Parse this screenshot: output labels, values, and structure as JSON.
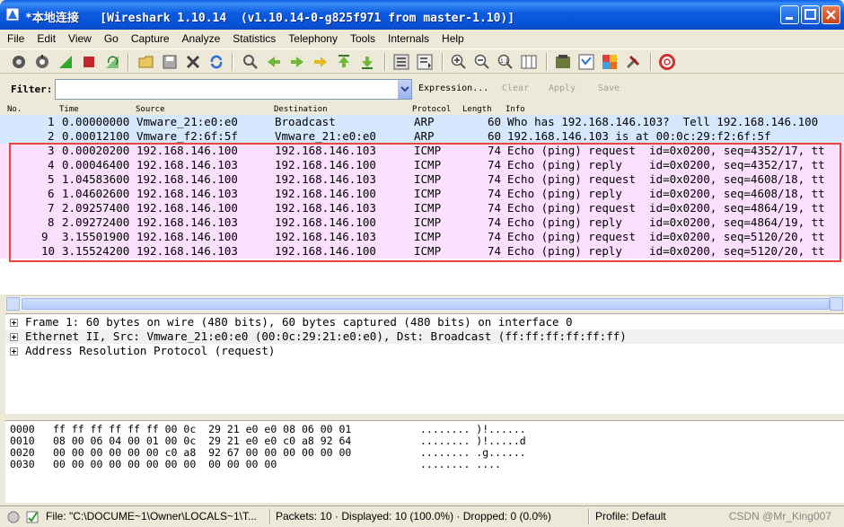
{
  "window": {
    "title": "*本地连接   [Wireshark 1.10.14  (v1.10.14-0-g825f971 from master-1.10)]",
    "accent": "#0A5FE8"
  },
  "menu": [
    "File",
    "Edit",
    "View",
    "Go",
    "Capture",
    "Analyze",
    "Statistics",
    "Telephony",
    "Tools",
    "Internals",
    "Help"
  ],
  "toolbar_icons": [
    "interfaces-icon",
    "options-icon",
    "start-capture-icon",
    "stop-capture-icon",
    "restart-capture-icon",
    "open-file-icon",
    "save-file-icon",
    "close-file-icon",
    "reload-icon",
    "find-packet-icon",
    "go-back-icon",
    "go-forward-icon",
    "go-to-packet-icon",
    "go-first-icon",
    "go-last-icon",
    "colorize-icon",
    "autoscroll-icon",
    "zoom-in-icon",
    "zoom-out-icon",
    "normal-size-icon",
    "resize-columns-icon",
    "capture-filters-icon",
    "display-filters-icon",
    "coloring-rules-icon",
    "preferences-icon",
    "help-icon"
  ],
  "filter": {
    "label": "Filter:",
    "value": "",
    "expression": "Expression...",
    "clear": "Clear",
    "apply": "Apply",
    "save": "Save"
  },
  "columns": [
    "No.",
    "Time",
    "Source",
    "Destination",
    "Protocol",
    "Length",
    "Info"
  ],
  "packets": [
    {
      "no": "1",
      "time": "0.00000000",
      "src": "Vmware_21:e0:e0",
      "dst": "Broadcast",
      "proto": "ARP",
      "len": "60",
      "info": "Who has 192.168.146.103?  Tell 192.168.146.100"
    },
    {
      "no": "2",
      "time": "0.00012100",
      "src": "Vmware_f2:6f:5f",
      "dst": "Vmware_21:e0:e0",
      "proto": "ARP",
      "len": "60",
      "info": "192.168.146.103 is at 00:0c:29:f2:6f:5f"
    },
    {
      "no": "3",
      "time": "0.00020200",
      "src": "192.168.146.100",
      "dst": "192.168.146.103",
      "proto": "ICMP",
      "len": "74",
      "info": "Echo (ping) request  id=0x0200, seq=4352/17, tt"
    },
    {
      "no": "4",
      "time": "0.00046400",
      "src": "192.168.146.103",
      "dst": "192.168.146.100",
      "proto": "ICMP",
      "len": "74",
      "info": "Echo (ping) reply    id=0x0200, seq=4352/17, tt"
    },
    {
      "no": "5",
      "time": "1.04583600",
      "src": "192.168.146.100",
      "dst": "192.168.146.103",
      "proto": "ICMP",
      "len": "74",
      "info": "Echo (ping) request  id=0x0200, seq=4608/18, tt"
    },
    {
      "no": "6",
      "time": "1.04602600",
      "src": "192.168.146.103",
      "dst": "192.168.146.100",
      "proto": "ICMP",
      "len": "74",
      "info": "Echo (ping) reply    id=0x0200, seq=4608/18, tt"
    },
    {
      "no": "7",
      "time": "2.09257400",
      "src": "192.168.146.100",
      "dst": "192.168.146.103",
      "proto": "ICMP",
      "len": "74",
      "info": "Echo (ping) request  id=0x0200, seq=4864/19, tt"
    },
    {
      "no": "8",
      "time": "2.09272400",
      "src": "192.168.146.103",
      "dst": "192.168.146.100",
      "proto": "ICMP",
      "len": "74",
      "info": "Echo (ping) reply    id=0x0200, seq=4864/19, tt"
    },
    {
      "no": "9",
      "time": "3.15501900",
      "src": "192.168.146.100",
      "dst": "192.168.146.103",
      "proto": "ICMP",
      "len": "74",
      "info": "Echo (ping) request  id=0x0200, seq=5120/20, tt"
    },
    {
      "no": "10",
      "time": "3.15524200",
      "src": "192.168.146.103",
      "dst": "192.168.146.100",
      "proto": "ICMP",
      "len": "74",
      "info": "Echo (ping) reply    id=0x0200, seq=5120/20, tt"
    }
  ],
  "details": [
    "Frame 1: 60 bytes on wire (480 bits), 60 bytes captured (480 bits) on interface 0",
    "Ethernet II, Src: Vmware_21:e0:e0 (00:0c:29:21:e0:e0), Dst: Broadcast (ff:ff:ff:ff:ff:ff)",
    "Address Resolution Protocol (request)"
  ],
  "bytes": [
    {
      "offset": "0000",
      "hex": "ff ff ff ff ff ff 00 0c  29 21 e0 e0 08 06 00 01",
      "ascii": "........ )!......"
    },
    {
      "offset": "0010",
      "hex": "08 00 06 04 00 01 00 0c  29 21 e0 e0 c0 a8 92 64",
      "ascii": "........ )!.....d"
    },
    {
      "offset": "0020",
      "hex": "00 00 00 00 00 00 c0 a8  92 67 00 00 00 00 00 00",
      "ascii": "........ .g......"
    },
    {
      "offset": "0030",
      "hex": "00 00 00 00 00 00 00 00  00 00 00 00",
      "ascii": "........ ...."
    }
  ],
  "status": {
    "file": "File: \"C:\\DOCUME~1\\Owner\\LOCALS~1\\T...",
    "counts": "Packets: 10 · Displayed: 10 (100.0%) · Dropped: 0 (0.0%)",
    "profile": "Profile: Default"
  },
  "watermark": "CSDN @Mr_King007",
  "colors": {
    "arp_row": "#D6E8FF",
    "icmp_row": "#FCE0FF",
    "highlight_box": "#E8473B"
  }
}
